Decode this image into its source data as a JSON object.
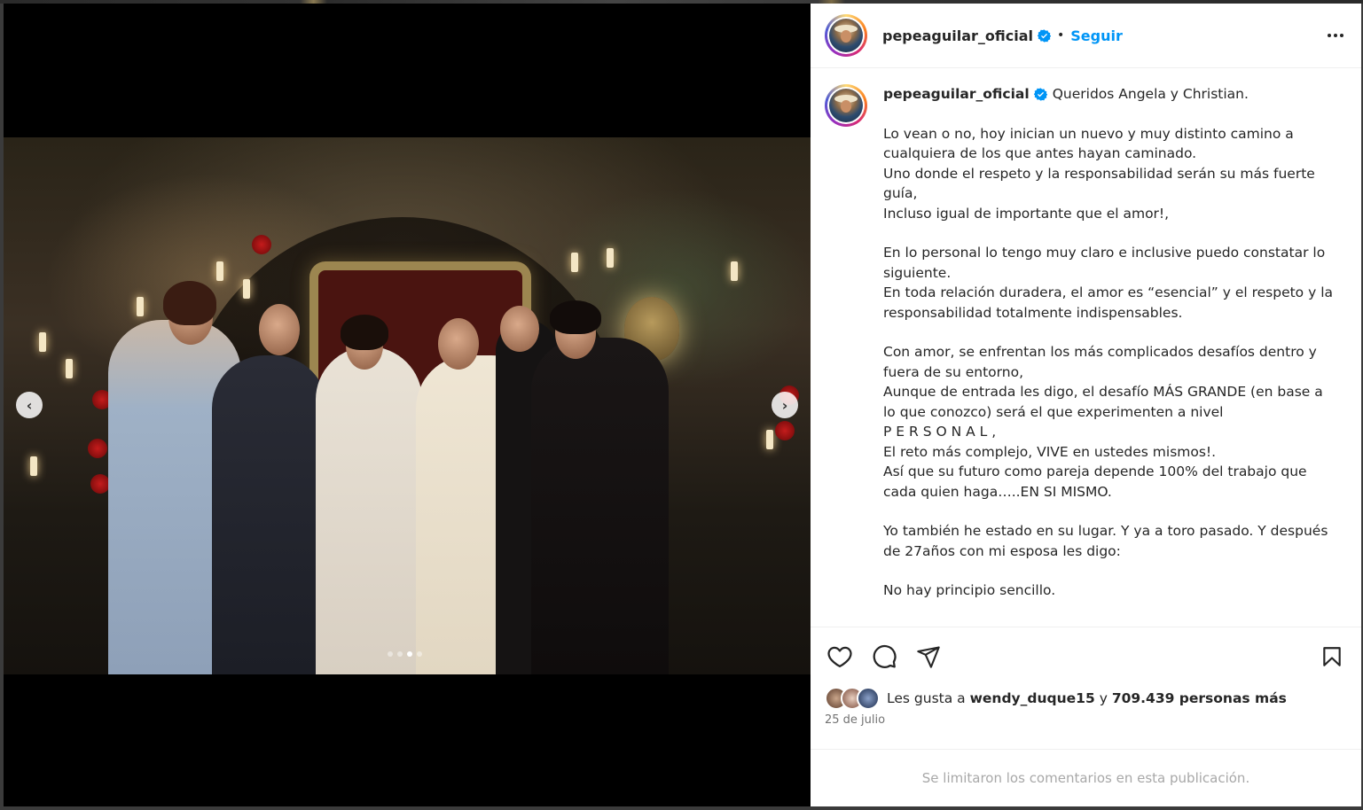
{
  "post": {
    "username": "pepeaguilar_oficial",
    "separator": "•",
    "follow_label": "Seguir",
    "caption_first_line": "Queridos Angela y Christian.",
    "caption_paragraphs": [
      "Lo vean o no, hoy inician un nuevo y muy distinto camino a\ncualquiera de los que antes hayan caminado.\nUno donde el respeto y la responsabilidad serán su más fuerte\nguía,\nIncluso igual de importante que el amor!,",
      "En lo personal lo tengo muy claro e inclusive puedo constatar lo\nsiguiente.\nEn toda relación duradera, el amor es “esencial” y el respeto y la\nresponsabilidad totalmente indispensables.",
      "Con amor, se enfrentan los más complicados desafíos dentro y\nfuera de su entorno,\nAunque de entrada les digo, el desafío MÁS GRANDE (en base a\nlo que conozco) será el que experimenten a nivel\nP E R S O N A L ,\nEl reto más complejo, VIVE en ustedes mismos!.\nAsí que su futuro como pareja depende 100% del trabajo que\ncada quien haga…..EN SI MISMO.",
      "Yo también he estado en su lugar. Y ya a toro pasado. Y después\nde 27años con mi esposa les digo:",
      "No hay principio sencillo."
    ],
    "likes_prefix": "Les gusta a",
    "likes_user": "wendy_duque15",
    "likes_conj": "y",
    "likes_count": "709.439 personas más",
    "date": "25 de julio",
    "comments_limited": "Se limitaron los comentarios en esta publicación."
  },
  "carousel": {
    "total_slides": 4,
    "active_slide": 3,
    "prev_glyph": "‹",
    "next_glyph": "›"
  },
  "colors": {
    "link_blue": "#0095f6",
    "verified_blue": "#0095f6",
    "muted_text": "#737373"
  },
  "icons": [
    "heart-icon",
    "comment-icon",
    "share-icon",
    "bookmark-icon",
    "verified-badge-icon",
    "more-icon"
  ]
}
